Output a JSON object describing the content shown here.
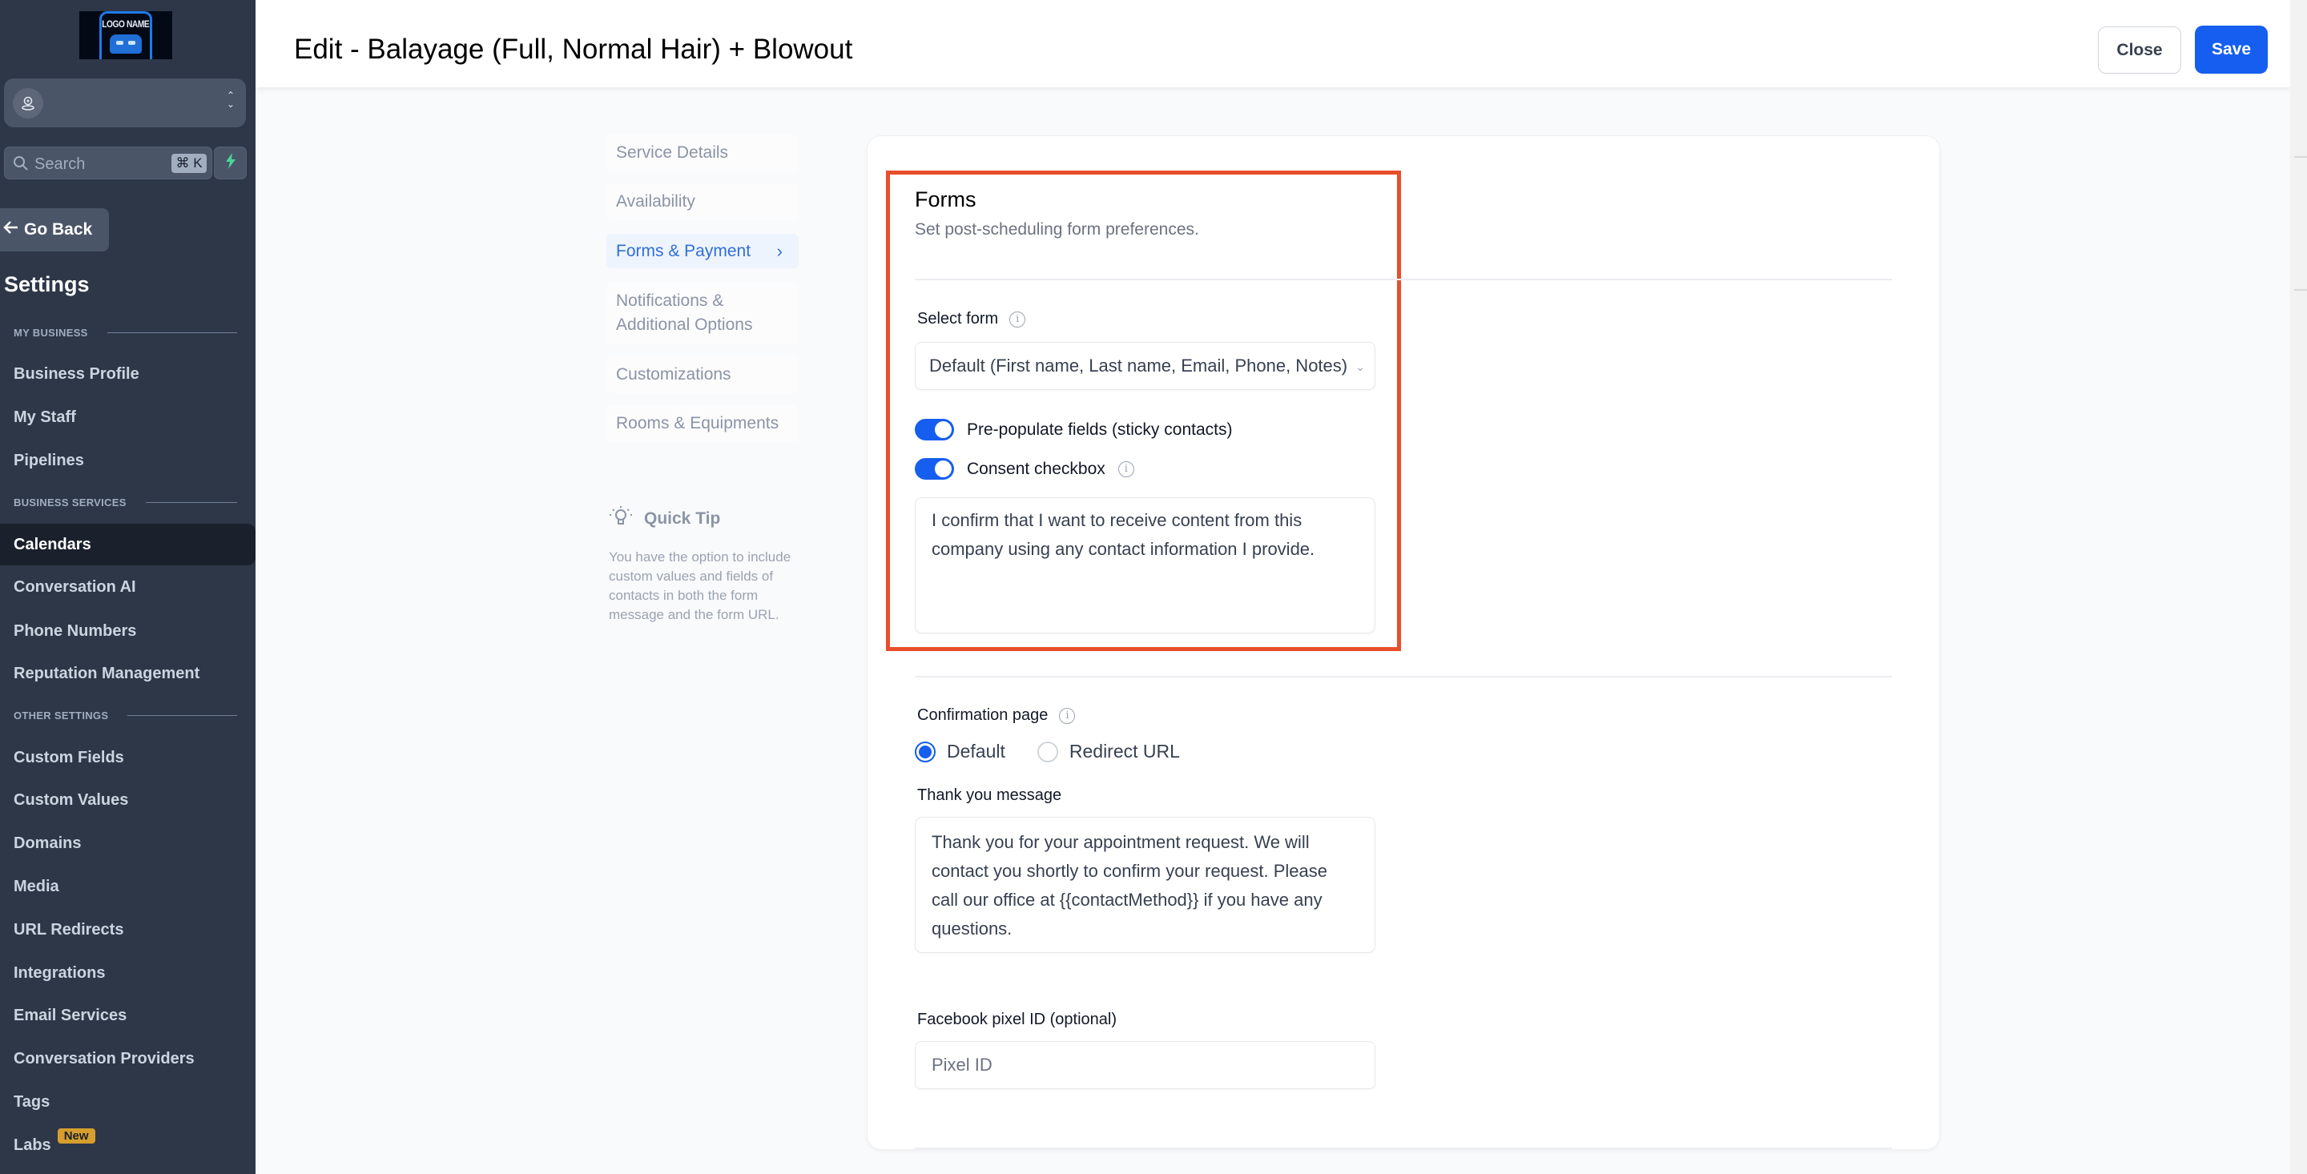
{
  "sidebar": {
    "logo_text": "LOGO NAME",
    "search_placeholder": "Search",
    "search_shortcut": "⌘ K",
    "go_back": "Go Back",
    "title": "Settings",
    "sections": {
      "my_business": "MY BUSINESS",
      "business_services": "BUSINESS SERVICES",
      "other_settings": "OTHER SETTINGS"
    },
    "items": [
      {
        "label": "Business Profile"
      },
      {
        "label": "My Staff"
      },
      {
        "label": "Pipelines"
      },
      {
        "label": "Calendars",
        "active": true
      },
      {
        "label": "Conversation AI"
      },
      {
        "label": "Phone Numbers"
      },
      {
        "label": "Reputation Management"
      },
      {
        "label": "Custom Fields"
      },
      {
        "label": "Custom Values"
      },
      {
        "label": "Domains"
      },
      {
        "label": "Media"
      },
      {
        "label": "URL Redirects"
      },
      {
        "label": "Integrations"
      },
      {
        "label": "Email Services"
      },
      {
        "label": "Conversation Providers"
      },
      {
        "label": "Tags"
      },
      {
        "label": "Labs",
        "badge": "New"
      }
    ]
  },
  "header": {
    "title": "Edit - Balayage (Full, Normal Hair) + Blowout",
    "close_label": "Close",
    "save_label": "Save"
  },
  "subnav": {
    "items": [
      {
        "label": "Service Details"
      },
      {
        "label": "Availability"
      },
      {
        "label": "Forms & Payment",
        "active": true
      },
      {
        "label": "Notifications & Additional Options"
      },
      {
        "label": "Customizations"
      },
      {
        "label": "Rooms & Equipments"
      }
    ],
    "tip_title": "Quick Tip",
    "tip_body": "You have the option to include custom values and fields of contacts in both the form message and the form URL."
  },
  "forms": {
    "title": "Forms",
    "subtitle": "Set post-scheduling form preferences.",
    "select_form_label": "Select form",
    "select_form_value": "Default (First name, Last name, Email, Phone, Notes)",
    "prepopulate_label": "Pre-populate fields (sticky contacts)",
    "prepopulate_on": true,
    "consent_label": "Consent checkbox",
    "consent_on": true,
    "consent_text": "I confirm that I want to receive content from this company using any contact information I provide.",
    "confirmation_label": "Confirmation page",
    "confirmation_options": [
      "Default",
      "Redirect URL"
    ],
    "confirmation_selected": "Default",
    "thank_you_label": "Thank you message",
    "thank_you_text": "Thank you for your appointment request. We will contact you shortly to confirm your request. Please call our office at {{contactMethod}} if you have any questions.",
    "pixel_label": "Facebook pixel ID (optional)",
    "pixel_placeholder": "Pixel ID",
    "pixel_value": ""
  },
  "colors": {
    "primary": "#155eef",
    "highlight_box": "#e94e2c",
    "sidebar_bg": "#2d3748",
    "new_badge": "#d69e2e"
  }
}
